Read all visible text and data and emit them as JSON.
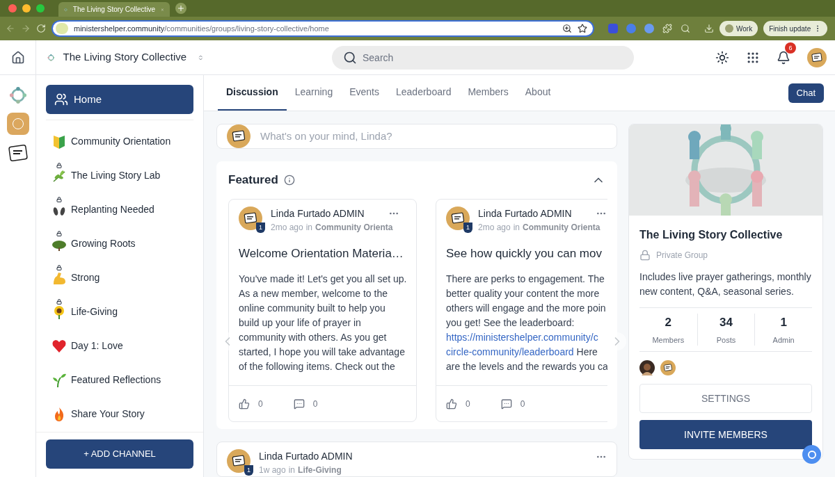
{
  "browser": {
    "tab_title": "The Living Story Collective",
    "url_host": "ministershelper.community",
    "url_path": "/communities/groups/living-story-collective/home",
    "profile": "Work",
    "update_button": "Finish update"
  },
  "header": {
    "community_name": "The Living Story Collective",
    "search": {
      "placeholder": "Search"
    },
    "notifications": "6"
  },
  "sidebar": {
    "home": {
      "label": "Home",
      "selected": true
    },
    "channels": [
      {
        "label": "Community Orientation",
        "locked": false,
        "selected": false
      },
      {
        "label": "The Living Story Lab",
        "locked": true,
        "selected": false
      },
      {
        "label": "Replanting Needed",
        "locked": true,
        "selected": false
      },
      {
        "label": "Growing Roots",
        "locked": true,
        "selected": false
      },
      {
        "label": "Strong",
        "locked": true,
        "selected": false
      },
      {
        "label": "Life-Giving",
        "locked": true,
        "selected": false
      },
      {
        "label": "Day 1: Love",
        "locked": false,
        "selected": false
      },
      {
        "label": "Featured Reflections",
        "locked": false,
        "selected": false
      },
      {
        "label": "Share Your Story",
        "locked": false,
        "selected": false
      }
    ],
    "add_button": "+ ADD CHANNEL"
  },
  "tabs": [
    {
      "label": "Discussion",
      "selected": true
    },
    {
      "label": "Learning",
      "selected": false
    },
    {
      "label": "Events",
      "selected": false
    },
    {
      "label": "Leaderboard",
      "selected": false
    },
    {
      "label": "Members",
      "selected": false
    },
    {
      "label": "About",
      "selected": false
    }
  ],
  "chat_button": "Chat",
  "composer": {
    "placeholder": "What's on your mind, Linda?"
  },
  "featured": {
    "title": "Featured",
    "expanded": true,
    "posts": [
      {
        "author": "Linda Furtado ADMIN",
        "badge": "1",
        "time": "2mo ago",
        "in": "in",
        "channel": "Community Orienta",
        "title": "Welcome Orientation Materia…",
        "lines": [
          [
            {
              "text": "You've made it! Let's get you all set up.",
              "link": false
            }
          ],
          [
            {
              "text": "As a new member, welcome to the",
              "link": false
            }
          ],
          [
            {
              "text": "online community built to help you",
              "link": false
            }
          ],
          [
            {
              "text": "build up your life of prayer in",
              "link": false
            }
          ],
          [
            {
              "text": "community with others. As you get",
              "link": false
            }
          ],
          [
            {
              "text": "started, I hope you will take advantage",
              "link": false
            }
          ],
          [
            {
              "text": "of the following items. Check out the",
              "link": false
            }
          ]
        ],
        "likes": "0",
        "comments": "0"
      },
      {
        "author": "Linda Furtado ADMIN",
        "badge": "1",
        "time": "2mo ago",
        "in": "in",
        "channel": "Community Orienta",
        "title": "See how quickly you can mov",
        "lines": [
          [
            {
              "text": "There are perks to engagement. The",
              "link": false
            }
          ],
          [
            {
              "text": "better quality your content the more",
              "link": false
            }
          ],
          [
            {
              "text": "others will engage and the more poin",
              "link": false
            }
          ],
          [
            {
              "text": "you get! See the leaderboard:",
              "link": false
            }
          ],
          [
            {
              "text": "https://ministershelper.community/c",
              "link": true
            }
          ],
          [
            {
              "text": "circle-community/leaderboard",
              "link": true
            },
            {
              "text": " Here",
              "link": false
            }
          ],
          [
            {
              "text": "are the levels and the rewards you ca",
              "link": false
            }
          ]
        ],
        "likes": "0",
        "comments": "0"
      }
    ]
  },
  "feed": [
    {
      "author": "Linda Furtado ADMIN",
      "badge": "1",
      "time": "1w ago",
      "in": "in",
      "channel": "Life-Giving"
    }
  ],
  "group": {
    "name": "The Living Story Collective",
    "privacy": "Private Group",
    "description": "Includes live prayer gatherings, monthly new content, Q&A, seasonal series.",
    "stats": [
      {
        "value": "2",
        "label": "Members"
      },
      {
        "value": "34",
        "label": "Posts"
      },
      {
        "value": "1",
        "label": "Admin"
      }
    ],
    "settings_button": "SETTINGS",
    "invite_button": "INVITE MEMBERS"
  }
}
